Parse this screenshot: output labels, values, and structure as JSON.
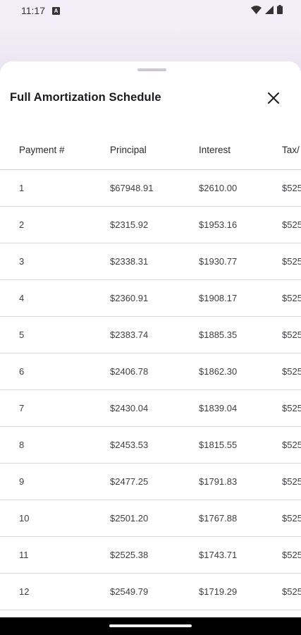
{
  "status_bar": {
    "time": "11:17",
    "notification_badge": "A",
    "icons": [
      "wifi-icon",
      "signal-icon",
      "battery-icon"
    ]
  },
  "sheet": {
    "title": "Full Amortization Schedule",
    "close_icon": "close-icon"
  },
  "table": {
    "headers": [
      "Payment #",
      "Principal",
      "Interest",
      "Tax/"
    ],
    "rows": [
      {
        "payment": "1",
        "principal": "$67948.91",
        "interest": "$2610.00",
        "tax": "$525"
      },
      {
        "payment": "2",
        "principal": "$2315.92",
        "interest": "$1953.16",
        "tax": "$525"
      },
      {
        "payment": "3",
        "principal": "$2338.31",
        "interest": "$1930.77",
        "tax": "$525"
      },
      {
        "payment": "4",
        "principal": "$2360.91",
        "interest": "$1908.17",
        "tax": "$525"
      },
      {
        "payment": "5",
        "principal": "$2383.74",
        "interest": "$1885.35",
        "tax": "$525"
      },
      {
        "payment": "6",
        "principal": "$2406.78",
        "interest": "$1862.30",
        "tax": "$525"
      },
      {
        "payment": "7",
        "principal": "$2430.04",
        "interest": "$1839.04",
        "tax": "$525"
      },
      {
        "payment": "8",
        "principal": "$2453.53",
        "interest": "$1815.55",
        "tax": "$525"
      },
      {
        "payment": "9",
        "principal": "$2477.25",
        "interest": "$1791.83",
        "tax": "$525"
      },
      {
        "payment": "10",
        "principal": "$2501.20",
        "interest": "$1767.88",
        "tax": "$525"
      },
      {
        "payment": "11",
        "principal": "$2525.38",
        "interest": "$1743.71",
        "tax": "$525"
      },
      {
        "payment": "12",
        "principal": "$2549.79",
        "interest": "$1719.29",
        "tax": "$525"
      }
    ]
  },
  "colors": {
    "background": "#f3eff8",
    "sheet": "#ffffff",
    "divider": "#dcdcdf",
    "text": "#1b1b1f"
  }
}
